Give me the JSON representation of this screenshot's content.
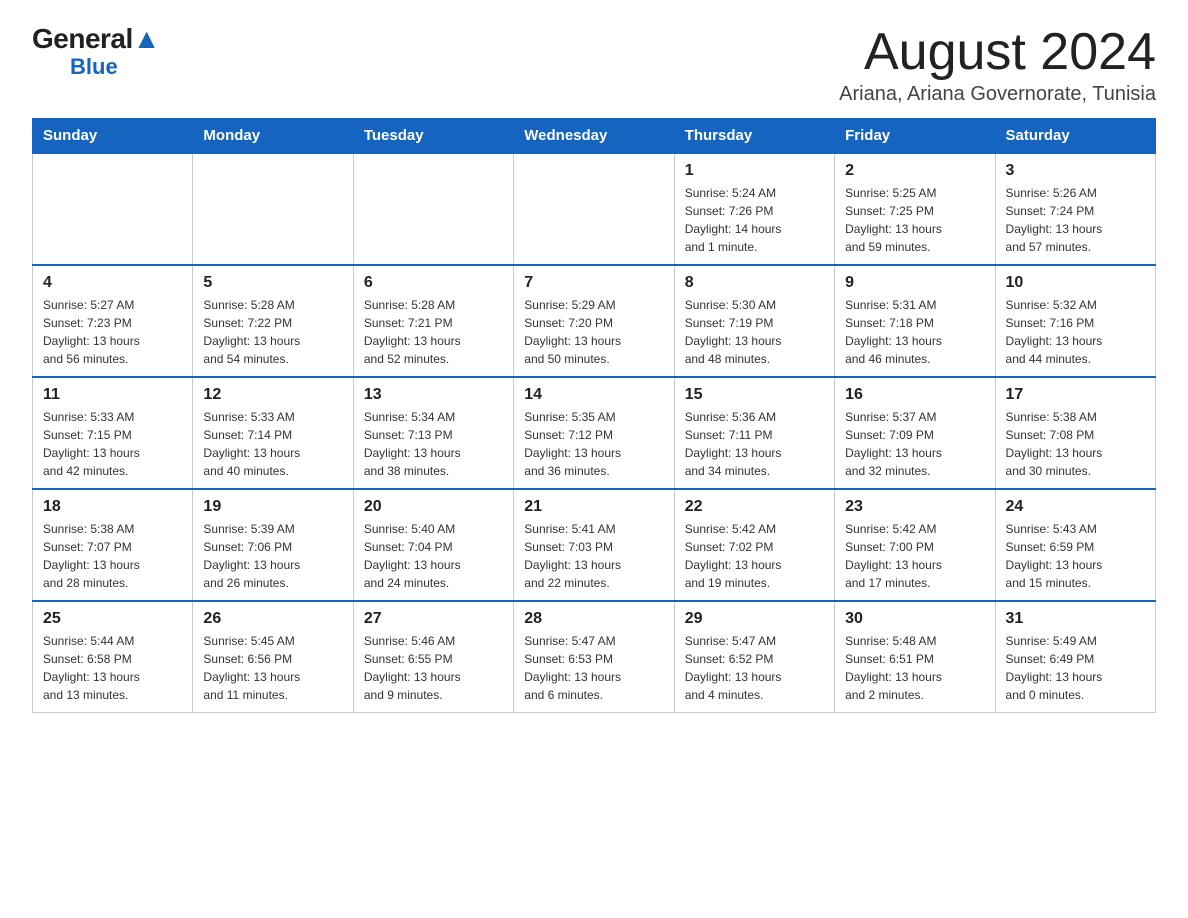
{
  "logo": {
    "general": "General",
    "blue_mark": "▼",
    "blue": "Blue"
  },
  "header": {
    "month_title": "August 2024",
    "location": "Ariana, Ariana Governorate, Tunisia"
  },
  "days_of_week": [
    "Sunday",
    "Monday",
    "Tuesday",
    "Wednesday",
    "Thursday",
    "Friday",
    "Saturday"
  ],
  "weeks": [
    [
      {
        "day": "",
        "info": ""
      },
      {
        "day": "",
        "info": ""
      },
      {
        "day": "",
        "info": ""
      },
      {
        "day": "",
        "info": ""
      },
      {
        "day": "1",
        "info": "Sunrise: 5:24 AM\nSunset: 7:26 PM\nDaylight: 14 hours\nand 1 minute."
      },
      {
        "day": "2",
        "info": "Sunrise: 5:25 AM\nSunset: 7:25 PM\nDaylight: 13 hours\nand 59 minutes."
      },
      {
        "day": "3",
        "info": "Sunrise: 5:26 AM\nSunset: 7:24 PM\nDaylight: 13 hours\nand 57 minutes."
      }
    ],
    [
      {
        "day": "4",
        "info": "Sunrise: 5:27 AM\nSunset: 7:23 PM\nDaylight: 13 hours\nand 56 minutes."
      },
      {
        "day": "5",
        "info": "Sunrise: 5:28 AM\nSunset: 7:22 PM\nDaylight: 13 hours\nand 54 minutes."
      },
      {
        "day": "6",
        "info": "Sunrise: 5:28 AM\nSunset: 7:21 PM\nDaylight: 13 hours\nand 52 minutes."
      },
      {
        "day": "7",
        "info": "Sunrise: 5:29 AM\nSunset: 7:20 PM\nDaylight: 13 hours\nand 50 minutes."
      },
      {
        "day": "8",
        "info": "Sunrise: 5:30 AM\nSunset: 7:19 PM\nDaylight: 13 hours\nand 48 minutes."
      },
      {
        "day": "9",
        "info": "Sunrise: 5:31 AM\nSunset: 7:18 PM\nDaylight: 13 hours\nand 46 minutes."
      },
      {
        "day": "10",
        "info": "Sunrise: 5:32 AM\nSunset: 7:16 PM\nDaylight: 13 hours\nand 44 minutes."
      }
    ],
    [
      {
        "day": "11",
        "info": "Sunrise: 5:33 AM\nSunset: 7:15 PM\nDaylight: 13 hours\nand 42 minutes."
      },
      {
        "day": "12",
        "info": "Sunrise: 5:33 AM\nSunset: 7:14 PM\nDaylight: 13 hours\nand 40 minutes."
      },
      {
        "day": "13",
        "info": "Sunrise: 5:34 AM\nSunset: 7:13 PM\nDaylight: 13 hours\nand 38 minutes."
      },
      {
        "day": "14",
        "info": "Sunrise: 5:35 AM\nSunset: 7:12 PM\nDaylight: 13 hours\nand 36 minutes."
      },
      {
        "day": "15",
        "info": "Sunrise: 5:36 AM\nSunset: 7:11 PM\nDaylight: 13 hours\nand 34 minutes."
      },
      {
        "day": "16",
        "info": "Sunrise: 5:37 AM\nSunset: 7:09 PM\nDaylight: 13 hours\nand 32 minutes."
      },
      {
        "day": "17",
        "info": "Sunrise: 5:38 AM\nSunset: 7:08 PM\nDaylight: 13 hours\nand 30 minutes."
      }
    ],
    [
      {
        "day": "18",
        "info": "Sunrise: 5:38 AM\nSunset: 7:07 PM\nDaylight: 13 hours\nand 28 minutes."
      },
      {
        "day": "19",
        "info": "Sunrise: 5:39 AM\nSunset: 7:06 PM\nDaylight: 13 hours\nand 26 minutes."
      },
      {
        "day": "20",
        "info": "Sunrise: 5:40 AM\nSunset: 7:04 PM\nDaylight: 13 hours\nand 24 minutes."
      },
      {
        "day": "21",
        "info": "Sunrise: 5:41 AM\nSunset: 7:03 PM\nDaylight: 13 hours\nand 22 minutes."
      },
      {
        "day": "22",
        "info": "Sunrise: 5:42 AM\nSunset: 7:02 PM\nDaylight: 13 hours\nand 19 minutes."
      },
      {
        "day": "23",
        "info": "Sunrise: 5:42 AM\nSunset: 7:00 PM\nDaylight: 13 hours\nand 17 minutes."
      },
      {
        "day": "24",
        "info": "Sunrise: 5:43 AM\nSunset: 6:59 PM\nDaylight: 13 hours\nand 15 minutes."
      }
    ],
    [
      {
        "day": "25",
        "info": "Sunrise: 5:44 AM\nSunset: 6:58 PM\nDaylight: 13 hours\nand 13 minutes."
      },
      {
        "day": "26",
        "info": "Sunrise: 5:45 AM\nSunset: 6:56 PM\nDaylight: 13 hours\nand 11 minutes."
      },
      {
        "day": "27",
        "info": "Sunrise: 5:46 AM\nSunset: 6:55 PM\nDaylight: 13 hours\nand 9 minutes."
      },
      {
        "day": "28",
        "info": "Sunrise: 5:47 AM\nSunset: 6:53 PM\nDaylight: 13 hours\nand 6 minutes."
      },
      {
        "day": "29",
        "info": "Sunrise: 5:47 AM\nSunset: 6:52 PM\nDaylight: 13 hours\nand 4 minutes."
      },
      {
        "day": "30",
        "info": "Sunrise: 5:48 AM\nSunset: 6:51 PM\nDaylight: 13 hours\nand 2 minutes."
      },
      {
        "day": "31",
        "info": "Sunrise: 5:49 AM\nSunset: 6:49 PM\nDaylight: 13 hours\nand 0 minutes."
      }
    ]
  ]
}
